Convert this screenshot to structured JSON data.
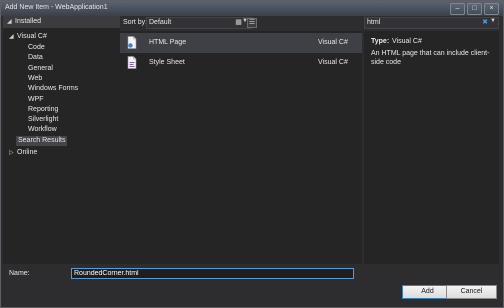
{
  "window": {
    "title": "Add New Item - WebApplication1",
    "controls": [
      "–",
      "□",
      "×"
    ]
  },
  "tree": {
    "root": "Installed",
    "visual_csharp": "Visual C#",
    "children": [
      "Code",
      "Data",
      "General",
      "Web",
      "Windows Forms",
      "WPF",
      "Reporting",
      "Silverlight",
      "Workflow",
      "Search Results"
    ],
    "online": "Online"
  },
  "sort": {
    "label": "Sort by:",
    "value": "Default"
  },
  "templates": [
    {
      "name": "HTML Page",
      "type": "Visual C#"
    },
    {
      "name": "Style Sheet",
      "type": "Visual C#"
    }
  ],
  "search": {
    "value": "html"
  },
  "details": {
    "type_label": "Type:",
    "type_value": "Visual C#",
    "description": "An HTML page that can include client-side code"
  },
  "name_field": {
    "label": "Name:",
    "value": "RoundedCorner.html"
  },
  "buttons": {
    "add": "Add",
    "cancel": "Cancel"
  }
}
